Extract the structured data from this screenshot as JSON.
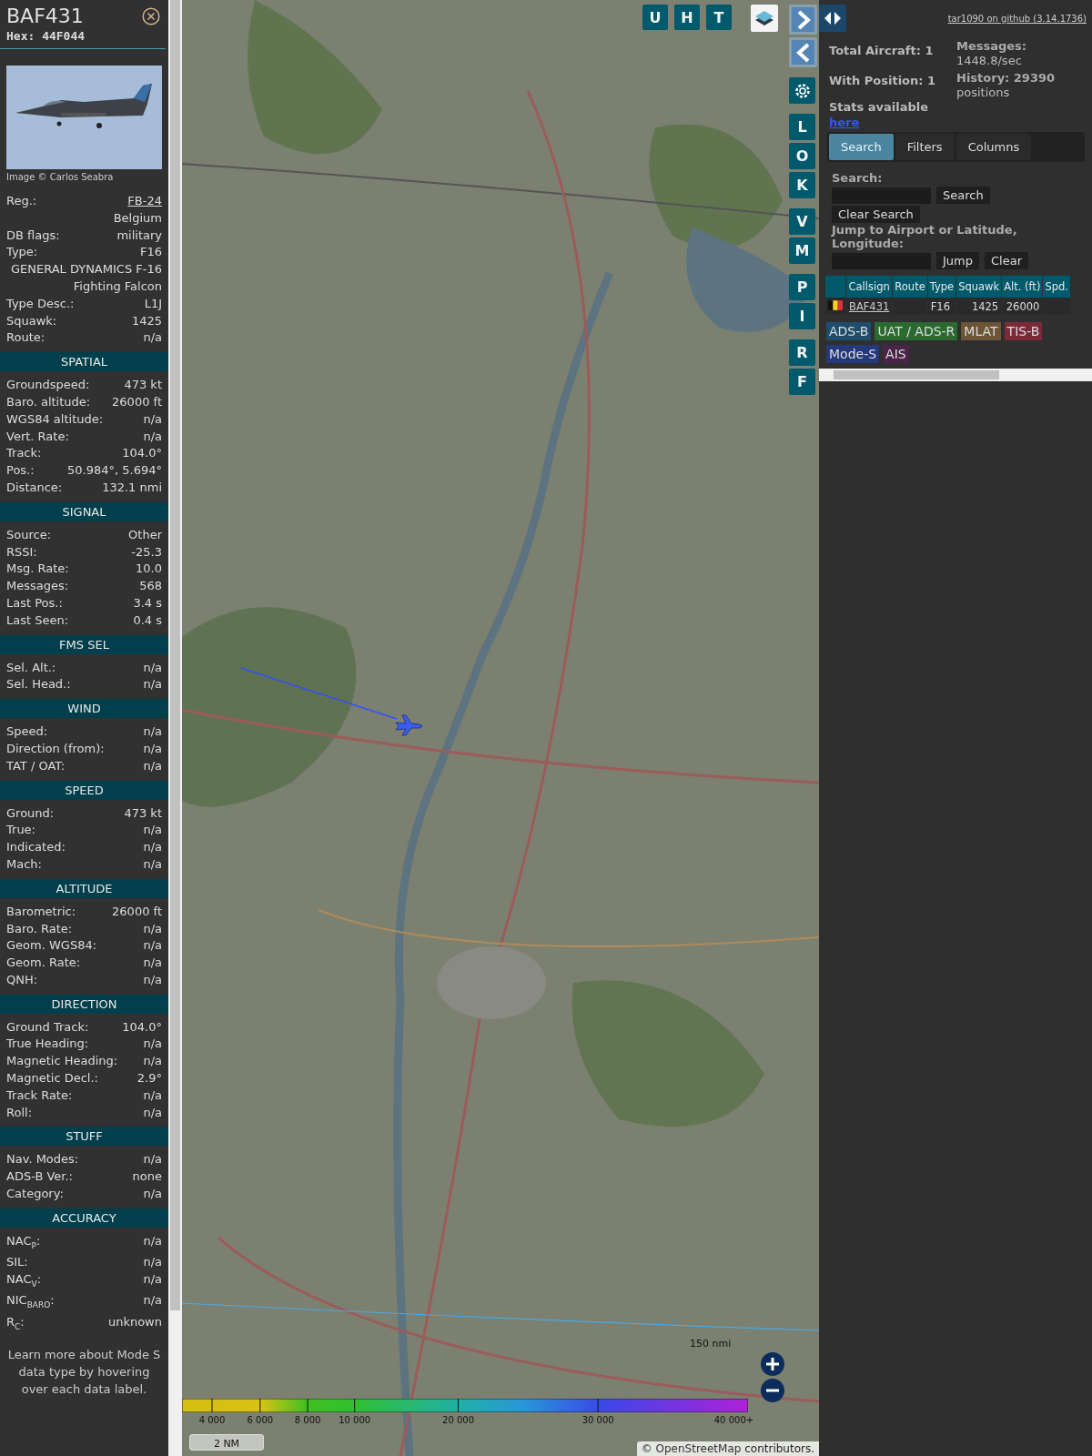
{
  "detail": {
    "callsign": "BAF431",
    "hex": "Hex: 44F044",
    "photo": {
      "kind": "picture"
    },
    "photo_credit": "Image © Carlos Seabra",
    "rows": [
      {
        "kind": "link",
        "label": "Reg.:",
        "value": "FB-24"
      },
      {
        "kind": "value",
        "value": "Belgium"
      },
      {
        "kind": "pair",
        "label": "DB flags:",
        "value": "military"
      },
      {
        "kind": "pair",
        "label": "Type:",
        "value": "F16"
      },
      {
        "kind": "value",
        "value": "GENERAL DYNAMICS F-16 Fighting Falcon"
      },
      {
        "kind": "pair",
        "label": "Type Desc.:",
        "value": "L1J"
      },
      {
        "kind": "pair",
        "label": "Squawk:",
        "value": "1425"
      },
      {
        "kind": "pair",
        "label": "Route:",
        "value": "n/a"
      }
    ],
    "sections": [
      {
        "title": "SPATIAL",
        "rows": [
          {
            "kind": "pair",
            "label": "Groundspeed:",
            "value": "473 kt"
          },
          {
            "kind": "pair",
            "label": "Baro. altitude:",
            "value": "26000 ft"
          },
          {
            "kind": "pair",
            "label": "WGS84 altitude:",
            "value": "n/a"
          },
          {
            "kind": "pair",
            "label": "Vert. Rate:",
            "value": "n/a"
          },
          {
            "kind": "pair",
            "label": "Track:",
            "value": "104.0°"
          },
          {
            "kind": "pair",
            "label": "Pos.:",
            "value": "50.984°, 5.694°"
          },
          {
            "kind": "pair",
            "label": "Distance:",
            "value": "132.1 nmi"
          }
        ]
      },
      {
        "title": "SIGNAL",
        "rows": [
          {
            "kind": "pair",
            "label": "Source:",
            "value": "Other"
          },
          {
            "kind": "pair",
            "label": "RSSI:",
            "value": "-25.3"
          },
          {
            "kind": "pair",
            "label": "Msg. Rate:",
            "value": "10.0"
          },
          {
            "kind": "pair",
            "label": "Messages:",
            "value": "568"
          },
          {
            "kind": "pair",
            "label": "Last Pos.:",
            "value": "3.4 s"
          },
          {
            "kind": "pair",
            "label": "Last Seen:",
            "value": "0.4 s"
          }
        ]
      },
      {
        "title": "FMS SEL",
        "rows": [
          {
            "kind": "pair",
            "label": "Sel. Alt.:",
            "value": "n/a"
          },
          {
            "kind": "pair",
            "label": "Sel. Head.:",
            "value": "n/a"
          }
        ]
      },
      {
        "title": "WIND",
        "rows": [
          {
            "kind": "pair",
            "label": "Speed:",
            "value": "n/a"
          },
          {
            "kind": "pair",
            "label": "Direction (from):",
            "value": "n/a"
          },
          {
            "kind": "pair",
            "label": "TAT / OAT:",
            "value": "n/a"
          }
        ]
      },
      {
        "title": "SPEED",
        "rows": [
          {
            "kind": "pair",
            "label": "Ground:",
            "value": "473 kt"
          },
          {
            "kind": "pair",
            "label": "True:",
            "value": "n/a"
          },
          {
            "kind": "pair",
            "label": "Indicated:",
            "value": "n/a"
          },
          {
            "kind": "pair",
            "label": "Mach:",
            "value": "n/a"
          }
        ]
      },
      {
        "title": "ALTITUDE",
        "rows": [
          {
            "kind": "pair",
            "label": "Barometric:",
            "value": "26000 ft"
          },
          {
            "kind": "pair",
            "label": "Baro. Rate:",
            "value": "n/a"
          },
          {
            "kind": "pair",
            "label": "Geom. WGS84:",
            "value": "n/a"
          },
          {
            "kind": "pair",
            "label": "Geom. Rate:",
            "value": "n/a"
          },
          {
            "kind": "pair",
            "label": "QNH:",
            "value": "n/a"
          }
        ]
      },
      {
        "title": "DIRECTION",
        "rows": [
          {
            "kind": "pair",
            "label": "Ground Track:",
            "value": "104.0°"
          },
          {
            "kind": "pair",
            "label": "True Heading:",
            "value": "n/a"
          },
          {
            "kind": "pair",
            "label": "Magnetic Heading:",
            "value": "n/a"
          },
          {
            "kind": "pair",
            "label": "Magnetic Decl.:",
            "value": "2.9°"
          },
          {
            "kind": "pair",
            "label": "Track Rate:",
            "value": "n/a"
          },
          {
            "kind": "pair",
            "label": "Roll:",
            "value": "n/a"
          }
        ]
      },
      {
        "title": "STUFF",
        "rows": [
          {
            "kind": "pair",
            "label": "Nav. Modes:",
            "value": "n/a"
          },
          {
            "kind": "pair",
            "label": "ADS-B Ver.:",
            "value": "none"
          },
          {
            "kind": "pair",
            "label": "Category:",
            "value": "n/a"
          }
        ]
      },
      {
        "title": "ACCURACY",
        "rows": [
          {
            "kind": "pair",
            "label": "NAC$_{P}$:",
            "value": "n/a"
          },
          {
            "kind": "pair",
            "label": "SIL:",
            "value": "n/a"
          },
          {
            "kind": "pair",
            "label": "NAC$_{V}$:",
            "value": "n/a"
          },
          {
            "kind": "pair",
            "label": "NIC$_{BARO}$:",
            "value": "n/a"
          },
          {
            "kind": "pair",
            "label": "R$_{C}$:",
            "value": "unknown"
          }
        ]
      }
    ],
    "note": "Learn more about Mode S data type by hovering over each data label."
  },
  "map": {
    "picture": {
      "kind": "picture"
    },
    "top_buttons": [
      "U",
      "H",
      "T"
    ],
    "side_groups": [
      [
        {
          "kind": "next"
        },
        {
          "kind": "prev"
        }
      ],
      [
        {
          "kind": "settings"
        }
      ],
      [
        {
          "kind": "letter",
          "label": "L"
        },
        {
          "kind": "letter",
          "label": "O"
        },
        {
          "kind": "letter",
          "label": "K"
        }
      ],
      [
        {
          "kind": "letter",
          "label": "V"
        },
        {
          "kind": "letter",
          "label": "M"
        }
      ],
      [
        {
          "kind": "letter",
          "label": "P"
        },
        {
          "kind": "letter",
          "label": "I"
        }
      ],
      [
        {
          "kind": "letter",
          "label": "R"
        },
        {
          "kind": "letter",
          "label": "F"
        }
      ]
    ],
    "range_label": "150 nmi",
    "altitude_labels": [
      "4 000",
      "6 000",
      "8 000",
      "10 000",
      "20 000",
      "30 000",
      "40 000+"
    ],
    "scale": "2 NM",
    "attribution": {
      "prefix": "©",
      "link": "OpenStreetMap",
      "suffix": "contributors."
    }
  },
  "panel": {
    "github_link": "tar1090 on github (3.14.1736)",
    "stats_left": [
      "Total Aircraft: 1",
      "With Position: 1"
    ],
    "stats_right": [
      "**Messages:** 1448.8/sec",
      "**History: 29390** positions"
    ],
    "stats_note": "Stats available",
    "stats_link": "here",
    "tabs": [
      {
        "label": "Search",
        "selected": true
      },
      {
        "label": "Filters",
        "selected": false
      },
      {
        "label": "Columns",
        "selected": false
      }
    ],
    "search_label": "Search:",
    "search_button": "Search",
    "clear_search_button": "Clear Search",
    "jump_label": "Jump to Airport or Latitude, Longitude:",
    "jump_button": "Jump",
    "clear_button": "Clear",
    "table": {
      "columns": [
        "",
        "Callsign",
        "Route",
        "Type",
        "Squawk",
        "Alt. (ft)",
        "Spd."
      ],
      "rows": [
        {
          "cells": [
            {
              "kind": "flag"
            },
            {
              "kind": "link",
              "text": "BAF431"
            },
            {
              "kind": "empty"
            },
            {
              "kind": "text",
              "text": "F16"
            },
            {
              "kind": "number",
              "text": "1425"
            },
            {
              "kind": "number",
              "text": "26000"
            },
            {
              "kind": "empty"
            }
          ]
        }
      ]
    },
    "sources": [
      {
        "label": "ADS-B",
        "color": "#1e4d6b"
      },
      {
        "label": "UAT / ADS-R",
        "color": "#2a6a30"
      },
      {
        "label": "MLAT",
        "color": "#6b5535"
      },
      {
        "label": "TIS-B",
        "color": "#7a2a38"
      },
      {
        "label": "Mode-S",
        "color": "#25387a"
      },
      {
        "label": "AIS",
        "color": "#4a2446"
      }
    ]
  }
}
